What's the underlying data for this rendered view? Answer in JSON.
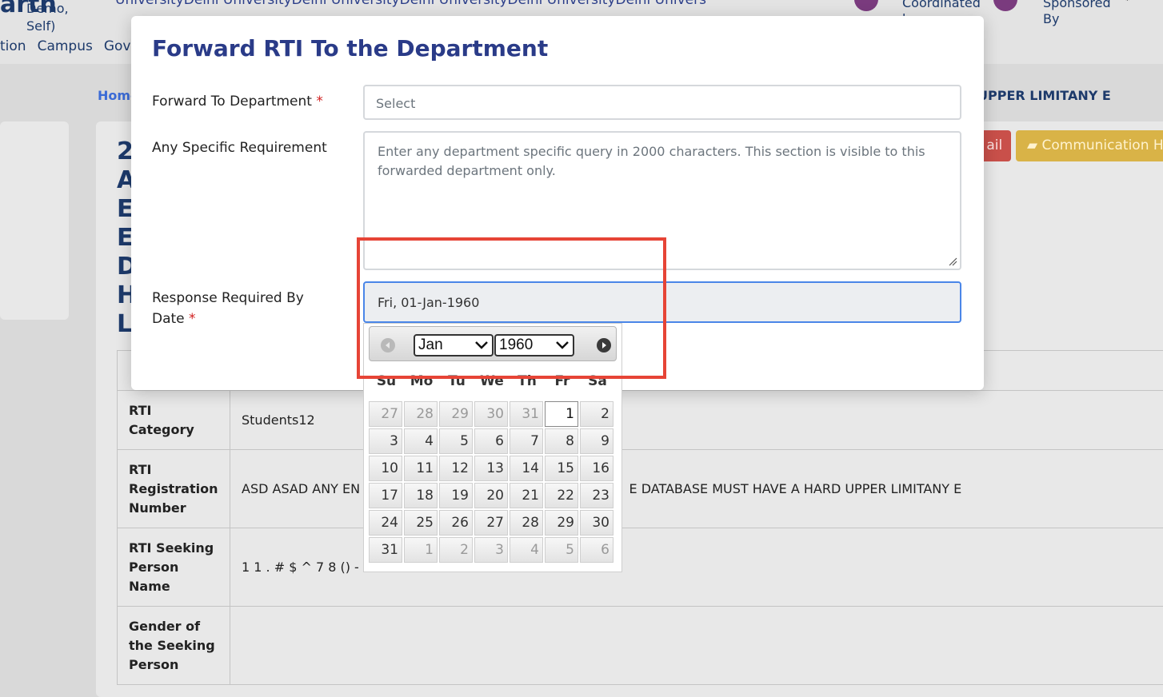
{
  "background": {
    "logo": "arth",
    "logo_sub": "(Demo,\nSelf)",
    "logo_sub_lines": [
      "Demo,",
      "Self)"
    ],
    "university_banner": "UniversityDelhi UniversityDelhi UniversityDelhi UniversityDelhi UniversityDelhi Univers",
    "coordinated_by": "Coordinated by",
    "sponsored_by": "Sponsored By",
    "nav": [
      "tion",
      "Campus",
      "Gov"
    ],
    "breadcrumb_home": "Home",
    "breadcrumb_right": "UPPER LIMITANY E",
    "heading_letters": [
      "2",
      "A",
      "E",
      "E",
      "D",
      "H",
      "L"
    ],
    "btn_mail": "ail",
    "btn_communication": "Communication H",
    "table": [
      {
        "key": "RTI Category",
        "value": "Students12"
      },
      {
        "key": "RTI Registration Number",
        "value": "ASD ASAD ANY EN",
        "value_right": "E DATABASE MUST HAVE A HARD UPPER LIMITANY E"
      },
      {
        "key": "RTI Seeking Person Name",
        "value": "1 1 . # $ ^ 7 8 () -"
      },
      {
        "key": "Gender of the Seeking Person",
        "value": ""
      }
    ]
  },
  "modal": {
    "title": "Forward RTI To the Department",
    "forward_label": "Forward To Department",
    "forward_placeholder": "Select",
    "requirement_label": "Any Specific Requirement",
    "requirement_placeholder": "Enter any department specific query in 2000 characters. This section is visible to this forwarded department only.",
    "response_label": "Response Required By Date",
    "response_value": "Fri, 01-Jan-1960",
    "required_marker": "*"
  },
  "datepicker": {
    "month": "Jan",
    "year": "1960",
    "weekdays": [
      "Su",
      "Mo",
      "Tu",
      "We",
      "Th",
      "Fr",
      "Sa"
    ],
    "weeks": [
      [
        {
          "d": "27",
          "o": true
        },
        {
          "d": "28",
          "o": true
        },
        {
          "d": "29",
          "o": true
        },
        {
          "d": "30",
          "o": true
        },
        {
          "d": "31",
          "o": true
        },
        {
          "d": "1",
          "today": true
        },
        {
          "d": "2"
        }
      ],
      [
        {
          "d": "3"
        },
        {
          "d": "4"
        },
        {
          "d": "5"
        },
        {
          "d": "6"
        },
        {
          "d": "7"
        },
        {
          "d": "8"
        },
        {
          "d": "9"
        }
      ],
      [
        {
          "d": "10"
        },
        {
          "d": "11"
        },
        {
          "d": "12"
        },
        {
          "d": "13"
        },
        {
          "d": "14"
        },
        {
          "d": "15"
        },
        {
          "d": "16"
        }
      ],
      [
        {
          "d": "17"
        },
        {
          "d": "18"
        },
        {
          "d": "19"
        },
        {
          "d": "20"
        },
        {
          "d": "21"
        },
        {
          "d": "22"
        },
        {
          "d": "23"
        }
      ],
      [
        {
          "d": "24"
        },
        {
          "d": "25"
        },
        {
          "d": "26"
        },
        {
          "d": "27"
        },
        {
          "d": "28"
        },
        {
          "d": "29"
        },
        {
          "d": "30"
        }
      ],
      [
        {
          "d": "31"
        },
        {
          "d": "1",
          "o": true
        },
        {
          "d": "2",
          "o": true
        },
        {
          "d": "3",
          "o": true
        },
        {
          "d": "4",
          "o": true
        },
        {
          "d": "5",
          "o": true
        },
        {
          "d": "6",
          "o": true
        }
      ]
    ]
  },
  "colors": {
    "annotation": "#e64436",
    "title": "#2a3b88",
    "required": "#d11f1f"
  }
}
